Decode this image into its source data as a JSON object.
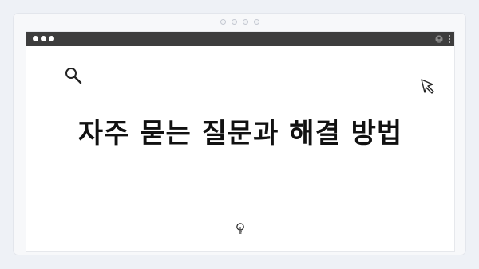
{
  "window": {
    "title": "자주 묻는 질문과 해결 방법"
  },
  "icons": {
    "search": "search-icon",
    "cursor": "cursor-icon",
    "lightbulb": "lightbulb-icon",
    "user": "user-icon",
    "menu": "kebab-menu-icon"
  },
  "colors": {
    "titlebar": "#3d3d3d",
    "background": "#eef1f6",
    "window": "#ffffff",
    "text": "#111111"
  }
}
